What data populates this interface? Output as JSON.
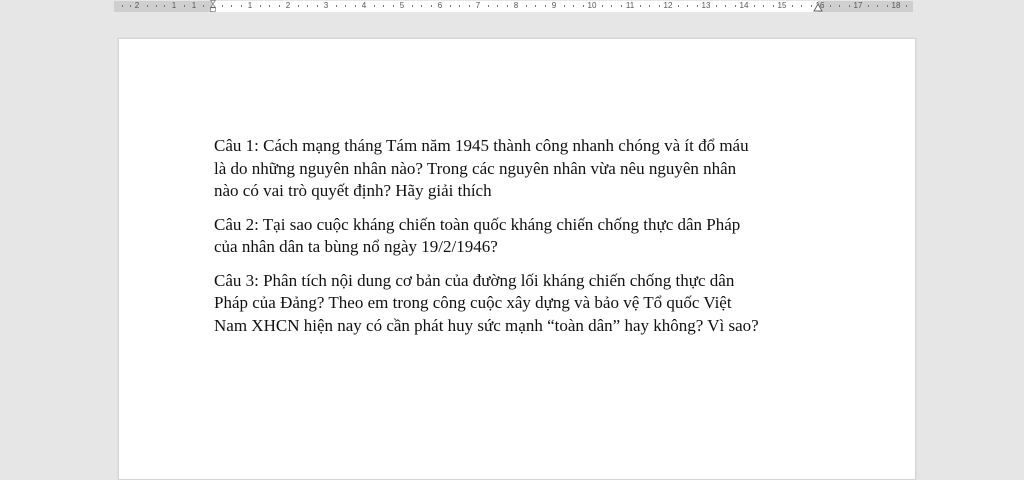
{
  "ruler": {
    "labels_left": [
      "2",
      "1",
      "1"
    ],
    "labels_right": [
      "1",
      "2",
      "3",
      "4",
      "5",
      "6",
      "7",
      "8",
      "9",
      "10",
      "11",
      "12",
      "13",
      "14",
      "15",
      "16",
      "17",
      "18"
    ]
  },
  "document": {
    "paragraphs": [
      "Câu 1: Cách mạng tháng Tám năm 1945 thành công nhanh chóng và ít đổ máu\nlà do những nguyên nhân nào? Trong các nguyên nhân vừa nêu nguyên nhân\nnào có vai trò quyết định? Hãy giải thích",
      "Câu 2: Tại sao cuộc kháng chiến toàn quốc kháng chiến chống thực dân Pháp\ncủa nhân dân ta bùng nổ ngày 19/2/1946?",
      "Câu 3: Phân tích nội dung cơ bản của đường lối kháng chiến chống thực dân\nPháp của Đảng? Theo em trong công cuộc xây dựng và bảo vệ Tổ quốc Việt\nNam XHCN hiện nay có cần phát huy sức mạnh “toàn dân” hay không? Vì sao?"
    ]
  }
}
